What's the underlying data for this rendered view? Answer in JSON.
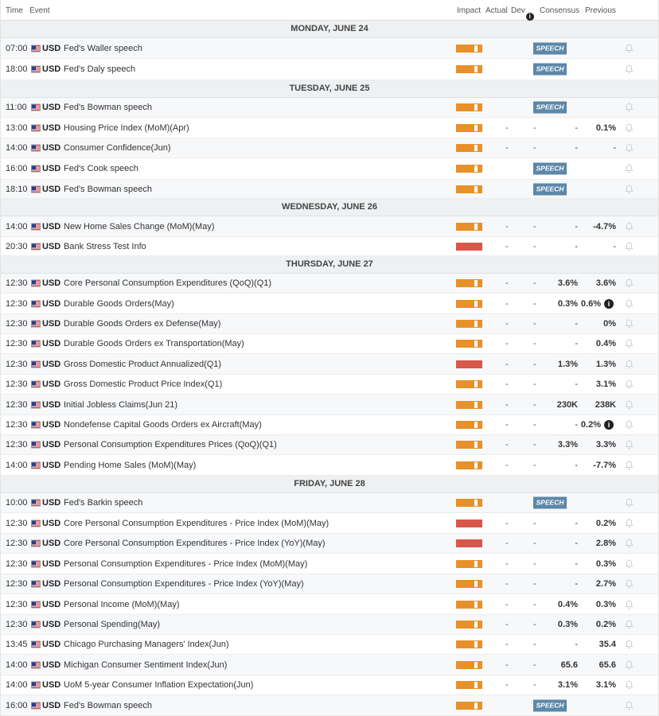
{
  "header": {
    "time": "Time",
    "event": "Event",
    "impact": "Impact",
    "actual": "Actual",
    "dev": "Dev",
    "consensus": "Consensus",
    "previous": "Previous",
    "info_glyph": "i"
  },
  "speech_label": "SPEECH",
  "days": [
    {
      "title": "MONDAY, JUNE 24",
      "rows": [
        {
          "time": "07:00",
          "cur": "USD",
          "event": "Fed's Waller speech",
          "impact": "med",
          "speech": true
        },
        {
          "time": "18:00",
          "cur": "USD",
          "event": "Fed's Daly speech",
          "impact": "med",
          "speech": true
        }
      ]
    },
    {
      "title": "TUESDAY, JUNE 25",
      "rows": [
        {
          "time": "11:00",
          "cur": "USD",
          "event": "Fed's Bowman speech",
          "impact": "med",
          "speech": true
        },
        {
          "time": "13:00",
          "cur": "USD",
          "event": "Housing Price Index (MoM)(Apr)",
          "impact": "med",
          "actual": "-",
          "dev": "-",
          "cons": "-",
          "prev": "0.1%"
        },
        {
          "time": "14:00",
          "cur": "USD",
          "event": "Consumer Confidence(Jun)",
          "impact": "med",
          "actual": "-",
          "dev": "-",
          "cons": "-",
          "prev": "-"
        },
        {
          "time": "16:00",
          "cur": "USD",
          "event": "Fed's Cook speech",
          "impact": "med",
          "speech": true
        },
        {
          "time": "18:10",
          "cur": "USD",
          "event": "Fed's Bowman speech",
          "impact": "med",
          "speech": true
        }
      ]
    },
    {
      "title": "WEDNESDAY, JUNE 26",
      "rows": [
        {
          "time": "14:00",
          "cur": "USD",
          "event": "New Home Sales Change (MoM)(May)",
          "impact": "med",
          "actual": "-",
          "dev": "-",
          "cons": "-",
          "prev": "-4.7%"
        },
        {
          "time": "20:30",
          "cur": "USD",
          "event": "Bank Stress Test Info",
          "impact": "high",
          "actual": "-",
          "dev": "-",
          "cons": "-",
          "prev": "-"
        }
      ]
    },
    {
      "title": "THURSDAY, JUNE 27",
      "rows": [
        {
          "time": "12:30",
          "cur": "USD",
          "event": "Core Personal Consumption Expenditures (QoQ)(Q1)",
          "impact": "med",
          "actual": "-",
          "dev": "-",
          "cons": "3.6%",
          "prev": "3.6%"
        },
        {
          "time": "12:30",
          "cur": "USD",
          "event": "Durable Goods Orders(May)",
          "impact": "med",
          "actual": "-",
          "dev": "-",
          "cons": "0.3%",
          "prev": "0.6%",
          "info": true
        },
        {
          "time": "12:30",
          "cur": "USD",
          "event": "Durable Goods Orders ex Defense(May)",
          "impact": "med",
          "actual": "-",
          "dev": "-",
          "cons": "-",
          "prev": "0%"
        },
        {
          "time": "12:30",
          "cur": "USD",
          "event": "Durable Goods Orders ex Transportation(May)",
          "impact": "med",
          "actual": "-",
          "dev": "-",
          "cons": "-",
          "prev": "0.4%"
        },
        {
          "time": "12:30",
          "cur": "USD",
          "event": "Gross Domestic Product Annualized(Q1)",
          "impact": "high",
          "actual": "-",
          "dev": "-",
          "cons": "1.3%",
          "prev": "1.3%"
        },
        {
          "time": "12:30",
          "cur": "USD",
          "event": "Gross Domestic Product Price Index(Q1)",
          "impact": "med",
          "actual": "-",
          "dev": "-",
          "cons": "-",
          "prev": "3.1%"
        },
        {
          "time": "12:30",
          "cur": "USD",
          "event": "Initial Jobless Claims(Jun 21)",
          "impact": "med",
          "actual": "-",
          "dev": "-",
          "cons": "230K",
          "prev": "238K"
        },
        {
          "time": "12:30",
          "cur": "USD",
          "event": "Nondefense Capital Goods Orders ex Aircraft(May)",
          "impact": "med",
          "actual": "-",
          "dev": "-",
          "cons": "-",
          "prev": "0.2%",
          "info": true
        },
        {
          "time": "12:30",
          "cur": "USD",
          "event": "Personal Consumption Expenditures Prices (QoQ)(Q1)",
          "impact": "med",
          "actual": "-",
          "dev": "-",
          "cons": "3.3%",
          "prev": "3.3%"
        },
        {
          "time": "14:00",
          "cur": "USD",
          "event": "Pending Home Sales (MoM)(May)",
          "impact": "med",
          "actual": "-",
          "dev": "-",
          "cons": "-",
          "prev": "-7.7%"
        }
      ]
    },
    {
      "title": "FRIDAY, JUNE 28",
      "rows": [
        {
          "time": "10:00",
          "cur": "USD",
          "event": "Fed's Barkin speech",
          "impact": "med",
          "speech": true
        },
        {
          "time": "12:30",
          "cur": "USD",
          "event": "Core Personal Consumption Expenditures - Price Index (MoM)(May)",
          "impact": "high",
          "actual": "-",
          "dev": "-",
          "cons": "-",
          "prev": "0.2%"
        },
        {
          "time": "12:30",
          "cur": "USD",
          "event": "Core Personal Consumption Expenditures - Price Index (YoY)(May)",
          "impact": "high",
          "actual": "-",
          "dev": "-",
          "cons": "-",
          "prev": "2.8%"
        },
        {
          "time": "12:30",
          "cur": "USD",
          "event": "Personal Consumption Expenditures - Price Index (MoM)(May)",
          "impact": "med",
          "actual": "-",
          "dev": "-",
          "cons": "-",
          "prev": "0.3%"
        },
        {
          "time": "12:30",
          "cur": "USD",
          "event": "Personal Consumption Expenditures - Price Index (YoY)(May)",
          "impact": "med",
          "actual": "-",
          "dev": "-",
          "cons": "-",
          "prev": "2.7%"
        },
        {
          "time": "12:30",
          "cur": "USD",
          "event": "Personal Income (MoM)(May)",
          "impact": "med",
          "actual": "-",
          "dev": "-",
          "cons": "0.4%",
          "prev": "0.3%"
        },
        {
          "time": "12:30",
          "cur": "USD",
          "event": "Personal Spending(May)",
          "impact": "med",
          "actual": "-",
          "dev": "-",
          "cons": "0.3%",
          "prev": "0.2%"
        },
        {
          "time": "13:45",
          "cur": "USD",
          "event": "Chicago Purchasing Managers' Index(Jun)",
          "impact": "med",
          "actual": "-",
          "dev": "-",
          "cons": "-",
          "prev": "35.4"
        },
        {
          "time": "14:00",
          "cur": "USD",
          "event": "Michigan Consumer Sentiment Index(Jun)",
          "impact": "med",
          "actual": "-",
          "dev": "-",
          "cons": "65.6",
          "prev": "65.6"
        },
        {
          "time": "14:00",
          "cur": "USD",
          "event": "UoM 5-year Consumer Inflation Expectation(Jun)",
          "impact": "med",
          "actual": "-",
          "dev": "-",
          "cons": "3.1%",
          "prev": "3.1%"
        },
        {
          "time": "16:00",
          "cur": "USD",
          "event": "Fed's Bowman speech",
          "impact": "med",
          "speech": true
        }
      ]
    }
  ]
}
